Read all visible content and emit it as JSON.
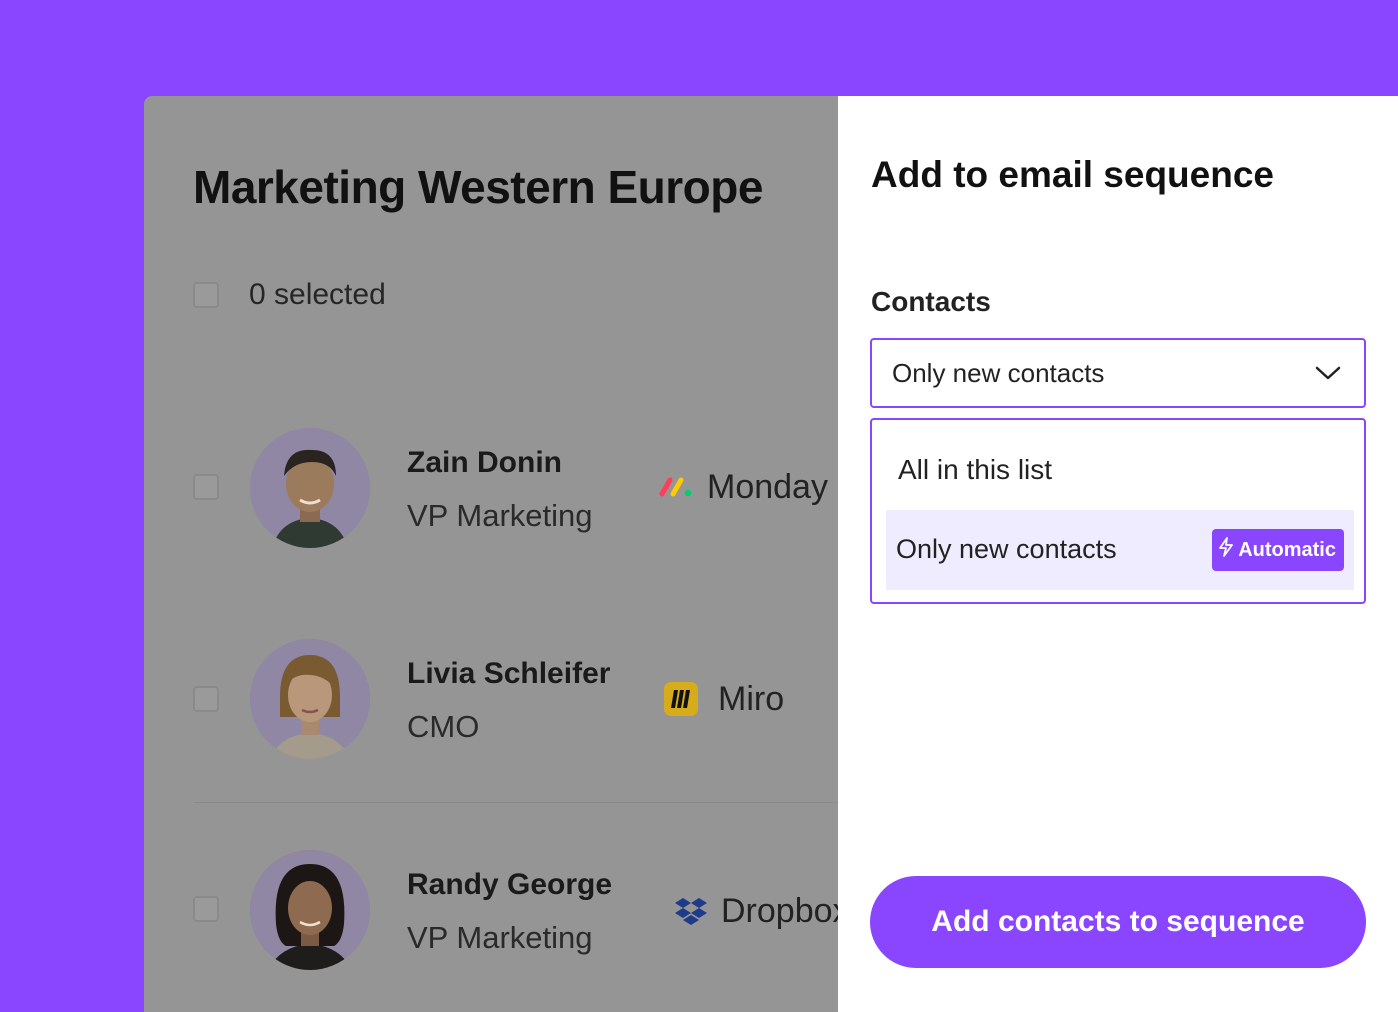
{
  "list": {
    "title": "Marketing Western Europe",
    "selected_label": "0 selected",
    "contacts": [
      {
        "name": "Zain Donin",
        "role": "VP Marketing",
        "company": "Monday",
        "company_icon": "monday-logo-icon"
      },
      {
        "name": "Livia Schleifer",
        "role": "CMO",
        "company": "Miro",
        "company_icon": "miro-logo-icon"
      },
      {
        "name": "Randy George",
        "role": "VP Marketing",
        "company": "Dropbox",
        "company_icon": "dropbox-logo-icon"
      }
    ]
  },
  "panel": {
    "title": "Add to email sequence",
    "contacts_label": "Contacts",
    "select_value": "Only new contacts",
    "options": [
      {
        "label": "All in this list"
      },
      {
        "label": "Only new contacts",
        "badge": "Automatic"
      }
    ],
    "cta_label": "Add contacts to sequence"
  },
  "colors": {
    "accent": "#8a45ff",
    "overlay_gray": "#959595",
    "option_highlight": "#f0ecff"
  }
}
